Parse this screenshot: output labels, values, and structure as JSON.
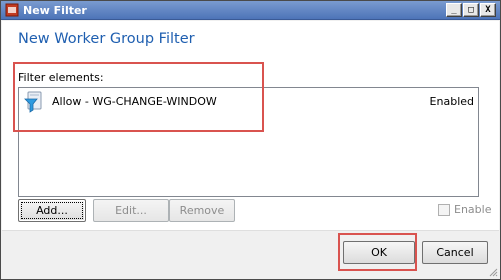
{
  "window": {
    "title": "New Filter",
    "controls": {
      "minimize": "_",
      "maximize": "□",
      "close": "X"
    }
  },
  "dialog": {
    "heading": "New Worker Group Filter",
    "filter_label": "Filter elements:",
    "items": [
      {
        "name": "Allow - WG-CHANGE-WINDOW",
        "status": "Enabled",
        "icon": "filter-funnel-icon"
      }
    ],
    "buttons": {
      "add": "Add...",
      "edit": "Edit...",
      "remove": "Remove",
      "enable": "Enable",
      "enable_checked": false
    },
    "footer": {
      "ok": "OK",
      "cancel": "Cancel"
    }
  },
  "colors": {
    "heading": "#1f5fb0",
    "highlight_box": "#d9534f",
    "titlebar": "#4d74b8"
  }
}
